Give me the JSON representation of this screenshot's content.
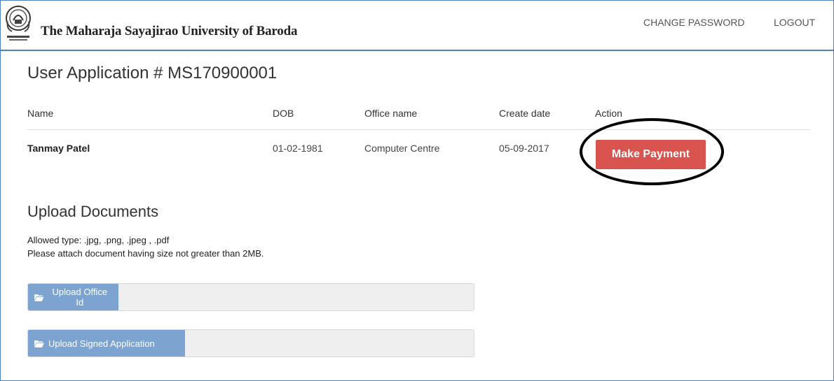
{
  "header": {
    "brand": "The Maharaja Sayajirao University of Baroda",
    "logo_icon": "university-seal-logo",
    "nav": {
      "change_password": "CHANGE PASSWORD",
      "logout": "LOGOUT"
    }
  },
  "main": {
    "title": "User Application # MS170900001",
    "table": {
      "columns": [
        "Name",
        "DOB",
        "Office name",
        "Create date",
        "Action"
      ],
      "rows": [
        {
          "name": "Tanmay Patel",
          "dob": "01-02-1981",
          "office": "Computer Centre",
          "create_date": "05-09-2017",
          "action_label": "Make Payment"
        }
      ]
    }
  },
  "upload": {
    "title": "Upload Documents",
    "allowed": "Allowed type: .jpg, .png, .jpeg , .pdf",
    "size_note": "Please attach document having size not greater than 2MB.",
    "fields": [
      {
        "label": "Upload Office Id",
        "icon": "folder-open-icon"
      },
      {
        "label": "Upload Signed Application",
        "icon": "folder-open-icon"
      }
    ]
  },
  "colors": {
    "accent_border": "#4f81bd",
    "payment_button": "#d9534f",
    "upload_button": "#7da4d1"
  }
}
